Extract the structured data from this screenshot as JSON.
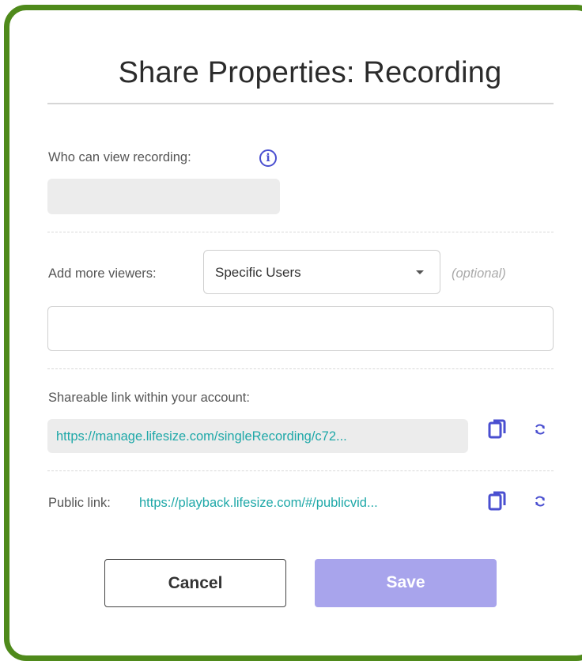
{
  "dialog": {
    "title": "Share Properties: Recording"
  },
  "viewers": {
    "label": "Who can view recording:",
    "info_icon": "info-icon"
  },
  "add_viewers": {
    "label": "Add more viewers:",
    "selected": "Specific Users",
    "optional": "(optional)"
  },
  "shareable": {
    "label": "Shareable link within your account:",
    "link": "https://manage.lifesize.com/singleRecording/c72...",
    "copy_icon": "copy-icon",
    "refresh_icon": "refresh-icon"
  },
  "public": {
    "label": "Public link:",
    "link": "https://playback.lifesize.com/#/publicvid...",
    "copy_icon": "copy-icon",
    "refresh_icon": "refresh-icon"
  },
  "actions": {
    "cancel": "Cancel",
    "save": "Save"
  },
  "colors": {
    "frame_border": "#4f8a1b",
    "accent": "#4a4fd0",
    "link": "#1ea8a8",
    "save_disabled": "#a8a4ec"
  }
}
